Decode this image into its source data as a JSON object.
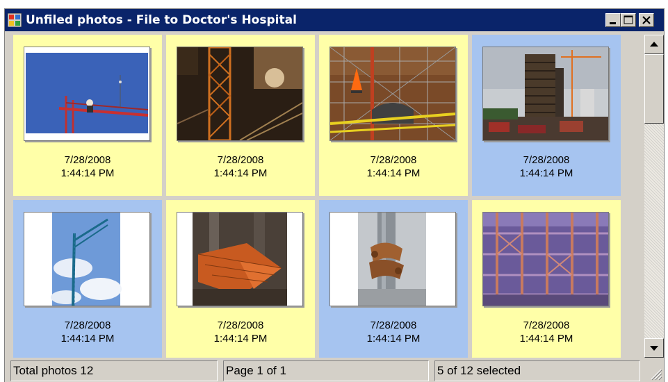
{
  "window": {
    "title": "Unfiled photos - File to Doctor's Hospital"
  },
  "titlebar_buttons": [
    {
      "name": "minimize-button",
      "icon": "minimize-icon"
    },
    {
      "name": "maximize-button",
      "icon": "maximize-icon"
    },
    {
      "name": "close-button",
      "icon": "close-icon"
    }
  ],
  "photos": [
    {
      "date": "7/28/2008",
      "time": "1:44:14 PM",
      "selected": false,
      "subject": "crane-worker-sky"
    },
    {
      "date": "7/28/2008",
      "time": "1:44:14 PM",
      "selected": false,
      "subject": "tower-crane-night"
    },
    {
      "date": "7/28/2008",
      "time": "1:44:14 PM",
      "selected": false,
      "subject": "rebar-cone"
    },
    {
      "date": "7/28/2008",
      "time": "1:44:14 PM",
      "selected": true,
      "subject": "building-city"
    },
    {
      "date": "7/28/2008",
      "time": "1:44:14 PM",
      "selected": true,
      "subject": "crane-sky-portrait"
    },
    {
      "date": "7/28/2008",
      "time": "1:44:14 PM",
      "selected": false,
      "subject": "site-from-above"
    },
    {
      "date": "7/28/2008",
      "time": "1:44:14 PM",
      "selected": true,
      "subject": "scaffold-clamp"
    },
    {
      "date": "7/28/2008",
      "time": "1:44:14 PM",
      "selected": false,
      "subject": "steel-scaffolding"
    }
  ],
  "status": {
    "total": "Total photos 12",
    "page": "Page 1 of 1",
    "selected": "5 of 12 selected"
  },
  "colors": {
    "titlebar": "#0a246a",
    "unselected_tile": "#ffffa8",
    "selected_tile": "#a6c4f0",
    "window_face": "#d4d0c8"
  }
}
